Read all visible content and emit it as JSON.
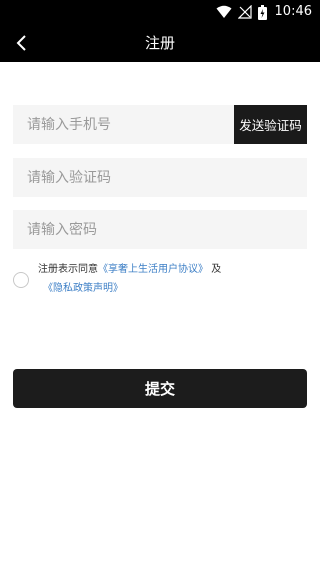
{
  "status_bar": {
    "time": "10:46",
    "icons": [
      "wifi-icon",
      "signal-icon",
      "battery-icon"
    ]
  },
  "nav": {
    "title": "注册",
    "back_icon": "chevron-left-icon"
  },
  "form": {
    "phone": {
      "placeholder": "请输入手机号",
      "value": ""
    },
    "send_code_label": "发送验证码",
    "code": {
      "placeholder": "请输入验证码",
      "value": ""
    },
    "password": {
      "placeholder": "请输入密码",
      "value": ""
    }
  },
  "agreement": {
    "checked": false,
    "prefix": "注册表示同意",
    "user_agreement": "《享奢上生活用户协议》",
    "conjunction": "及",
    "privacy_policy": "《隐私政策声明》"
  },
  "submit_label": "提交",
  "colors": {
    "bar_background": "#000000",
    "input_background": "#f5f5f5",
    "button_background": "#1c1c1c",
    "link": "#3d7fc6"
  }
}
